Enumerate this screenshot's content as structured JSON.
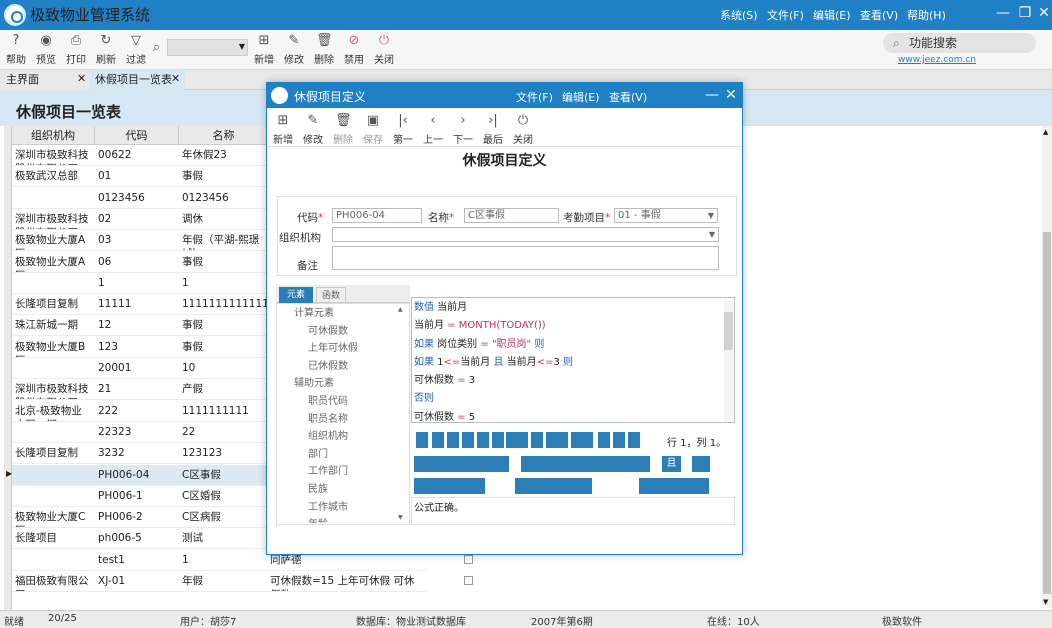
{
  "app": {
    "title": "极致物业管理系统",
    "menus": [
      "系统(S)",
      "文件(F)",
      "编辑(E)",
      "查看(V)",
      "帮助(H)"
    ]
  },
  "toolbar": {
    "items": [
      "帮助",
      "预览",
      "打印",
      "刷新",
      "过滤",
      "新增",
      "修改",
      "删除",
      "禁用",
      "关闭"
    ],
    "search": "功能搜索",
    "website": "www.jeez.com.cn"
  },
  "tabs": [
    "主界面",
    "休假项目一览表"
  ],
  "main": {
    "title": "休假项目一览表",
    "headers": [
      "组织机构",
      "代码",
      "名称"
    ],
    "rows": [
      [
        "深圳市极致科技股份有限公司",
        "00622",
        "年休假23"
      ],
      [
        "极致武汉总部",
        "01",
        "事假"
      ],
      [
        "",
        "0123456",
        "0123456"
      ],
      [
        "深圳市极致科技股份有限公司",
        "02",
        "调休"
      ],
      [
        "极致物业大厦A区",
        "03",
        "年假（平湖-熙璟城）"
      ],
      [
        "极致物业大厦A区",
        "06",
        "事假"
      ],
      [
        "",
        "1",
        "1"
      ],
      [
        "长隆项目复制",
        "11111",
        "1111111111111111"
      ],
      [
        "珠江新城一期",
        "12",
        "事假"
      ],
      [
        "极致物业大厦B区",
        "123",
        "事假"
      ],
      [
        "",
        "20001",
        "10"
      ],
      [
        "深圳市极致科技股份有限公司",
        "21",
        "产假"
      ],
      [
        "北京-极致物业小区一期",
        "222",
        "1111111111"
      ],
      [
        "",
        "22323",
        "22"
      ],
      [
        "长隆项目复制",
        "3232",
        "123123"
      ],
      [
        "",
        "PH006-04",
        "C区事假"
      ],
      [
        "",
        "PH006-1",
        "C区婚假"
      ],
      [
        "极致物业大厦C区",
        "PH006-2",
        "C区病假"
      ],
      [
        "长隆项目",
        "ph006-5",
        "测试"
      ],
      [
        "",
        "test1",
        "1"
      ],
      [
        "福田极致有限公司",
        "XJ-01",
        "年假"
      ]
    ],
    "extra_col": [
      "同萨德",
      "可休假数=15 上年可休假 可休假数"
    ]
  },
  "status": {
    "state": "就绪",
    "page": "20/25",
    "user": "用户：胡莎7",
    "db": "数据库：物业测试数据库",
    "period": "2007年第6期",
    "online": "在线：10人",
    "company": "极致软件"
  },
  "dialog": {
    "title": "休假项目定义",
    "menus": [
      "文件(F)",
      "编辑(E)",
      "查看(V)"
    ],
    "toolbar": [
      "新增",
      "修改",
      "删除",
      "保存",
      "第一",
      "上一",
      "下一",
      "最后",
      "关闭"
    ],
    "heading": "休假项目定义",
    "code_label": "代码",
    "code_value": "PH006-04",
    "name_label": "名称",
    "name_value": "C区事假",
    "att_label": "考勤项目",
    "att_value": "01 - 事假",
    "org_label": "组织机构",
    "note_label": "备注",
    "tabs": [
      "元素",
      "函数"
    ],
    "tree": [
      "计算元素",
      "可休假数",
      "上年可休假",
      "已休假数",
      "辅助元素",
      "职员代码",
      "职员名称",
      "组织机构",
      "部门",
      "工作部门",
      "民族",
      "工作城市",
      "年龄"
    ],
    "formula": [
      "数值 当前月",
      "当前月 = MONTH(TODAY())",
      "如果 岗位类别 = \"职员岗\" 则",
      "如果 1<=当前月 且 当前月<=3 则",
      "可休假数 = 3",
      "否则",
      "可休假数 = 5"
    ],
    "pos": "行 1，列 1。",
    "and_btn": "且",
    "result": "公式正确。"
  }
}
